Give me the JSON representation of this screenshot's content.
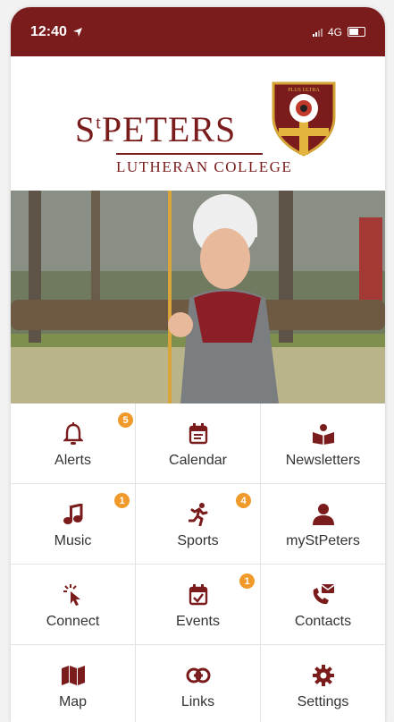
{
  "status_bar": {
    "time": "12:40",
    "network": "4G"
  },
  "header": {
    "school_name_prefix": "S",
    "school_name_sup": "t",
    "school_name_main": "PETERS",
    "school_subtitle": "LUTHERAN COLLEGE",
    "crest_text": "PLUS ULTRA"
  },
  "colors": {
    "brand": "#7a1c1c",
    "badge": "#ef9a2a"
  },
  "tiles": [
    {
      "label": "Alerts",
      "icon": "bell-icon",
      "badge": "5"
    },
    {
      "label": "Calendar",
      "icon": "calendar-icon",
      "badge": ""
    },
    {
      "label": "Newsletters",
      "icon": "book-reader-icon",
      "badge": ""
    },
    {
      "label": "Music",
      "icon": "music-note-icon",
      "badge": "1"
    },
    {
      "label": "Sports",
      "icon": "running-icon",
      "badge": "4"
    },
    {
      "label": "myStPeters",
      "icon": "user-icon",
      "badge": ""
    },
    {
      "label": "Connect",
      "icon": "cursor-click-icon",
      "badge": ""
    },
    {
      "label": "Events",
      "icon": "calendar-check-icon",
      "badge": "1"
    },
    {
      "label": "Contacts",
      "icon": "phone-mail-icon",
      "badge": ""
    },
    {
      "label": "Map",
      "icon": "map-icon",
      "badge": ""
    },
    {
      "label": "Links",
      "icon": "link-icon",
      "badge": ""
    },
    {
      "label": "Settings",
      "icon": "gear-icon",
      "badge": ""
    }
  ]
}
